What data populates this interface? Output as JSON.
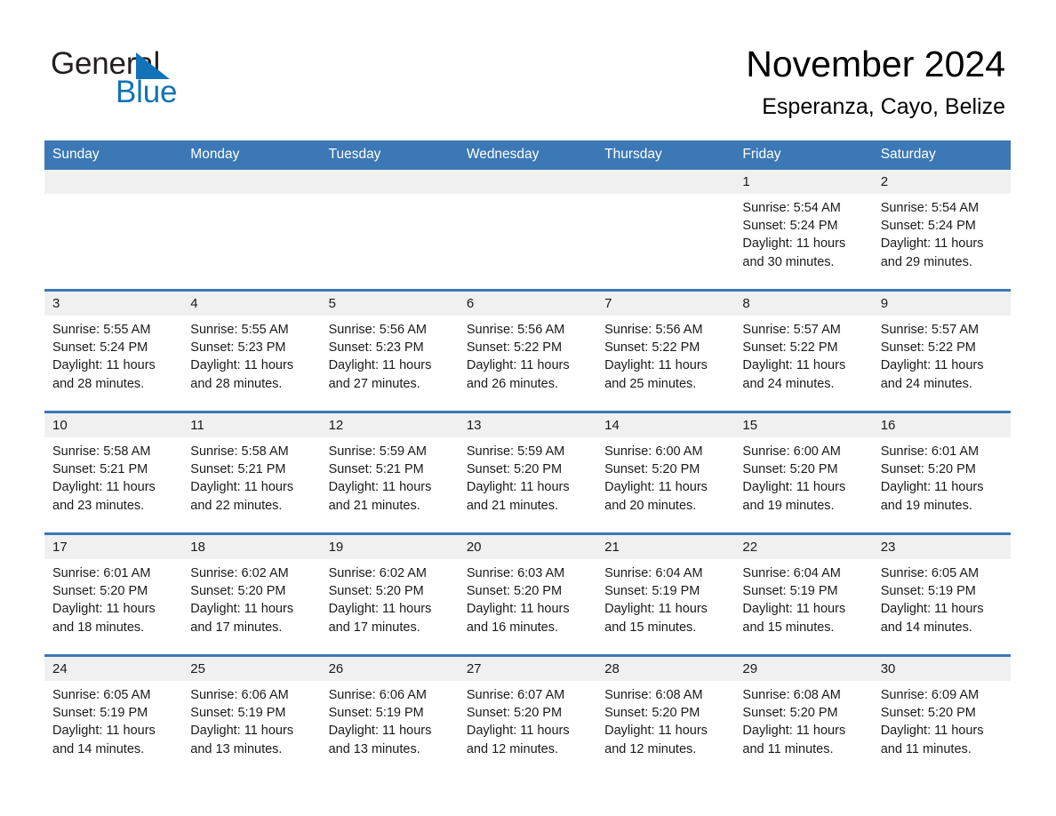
{
  "logo": {
    "text_top": "General",
    "text_bottom": "Blue",
    "triangle_icon": "blue-triangle-icon",
    "colors": {
      "black": "#231f20",
      "blue": "#1273b8"
    }
  },
  "header": {
    "title": "November 2024",
    "subtitle": "Esperanza, Cayo, Belize"
  },
  "theme": {
    "header_blue": "#3b78b5",
    "daynum_band_gray": "#f0f0f0",
    "cell_white": "#ffffff",
    "text_black": "#1a1a1a"
  },
  "calendar": {
    "weekday_headers": [
      "Sunday",
      "Monday",
      "Tuesday",
      "Wednesday",
      "Thursday",
      "Friday",
      "Saturday"
    ],
    "weeks": [
      [
        {
          "day": "",
          "sunrise": "",
          "sunset": "",
          "daylight": "",
          "blank": true
        },
        {
          "day": "",
          "sunrise": "",
          "sunset": "",
          "daylight": "",
          "blank": true
        },
        {
          "day": "",
          "sunrise": "",
          "sunset": "",
          "daylight": "",
          "blank": true
        },
        {
          "day": "",
          "sunrise": "",
          "sunset": "",
          "daylight": "",
          "blank": true
        },
        {
          "day": "",
          "sunrise": "",
          "sunset": "",
          "daylight": "",
          "blank": true
        },
        {
          "day": "1",
          "sunrise": "Sunrise: 5:54 AM",
          "sunset": "Sunset: 5:24 PM",
          "daylight": "Daylight: 11 hours and 30 minutes."
        },
        {
          "day": "2",
          "sunrise": "Sunrise: 5:54 AM",
          "sunset": "Sunset: 5:24 PM",
          "daylight": "Daylight: 11 hours and 29 minutes."
        }
      ],
      [
        {
          "day": "3",
          "sunrise": "Sunrise: 5:55 AM",
          "sunset": "Sunset: 5:24 PM",
          "daylight": "Daylight: 11 hours and 28 minutes."
        },
        {
          "day": "4",
          "sunrise": "Sunrise: 5:55 AM",
          "sunset": "Sunset: 5:23 PM",
          "daylight": "Daylight: 11 hours and 28 minutes."
        },
        {
          "day": "5",
          "sunrise": "Sunrise: 5:56 AM",
          "sunset": "Sunset: 5:23 PM",
          "daylight": "Daylight: 11 hours and 27 minutes."
        },
        {
          "day": "6",
          "sunrise": "Sunrise: 5:56 AM",
          "sunset": "Sunset: 5:22 PM",
          "daylight": "Daylight: 11 hours and 26 minutes."
        },
        {
          "day": "7",
          "sunrise": "Sunrise: 5:56 AM",
          "sunset": "Sunset: 5:22 PM",
          "daylight": "Daylight: 11 hours and 25 minutes."
        },
        {
          "day": "8",
          "sunrise": "Sunrise: 5:57 AM",
          "sunset": "Sunset: 5:22 PM",
          "daylight": "Daylight: 11 hours and 24 minutes."
        },
        {
          "day": "9",
          "sunrise": "Sunrise: 5:57 AM",
          "sunset": "Sunset: 5:22 PM",
          "daylight": "Daylight: 11 hours and 24 minutes."
        }
      ],
      [
        {
          "day": "10",
          "sunrise": "Sunrise: 5:58 AM",
          "sunset": "Sunset: 5:21 PM",
          "daylight": "Daylight: 11 hours and 23 minutes."
        },
        {
          "day": "11",
          "sunrise": "Sunrise: 5:58 AM",
          "sunset": "Sunset: 5:21 PM",
          "daylight": "Daylight: 11 hours and 22 minutes."
        },
        {
          "day": "12",
          "sunrise": "Sunrise: 5:59 AM",
          "sunset": "Sunset: 5:21 PM",
          "daylight": "Daylight: 11 hours and 21 minutes."
        },
        {
          "day": "13",
          "sunrise": "Sunrise: 5:59 AM",
          "sunset": "Sunset: 5:20 PM",
          "daylight": "Daylight: 11 hours and 21 minutes."
        },
        {
          "day": "14",
          "sunrise": "Sunrise: 6:00 AM",
          "sunset": "Sunset: 5:20 PM",
          "daylight": "Daylight: 11 hours and 20 minutes."
        },
        {
          "day": "15",
          "sunrise": "Sunrise: 6:00 AM",
          "sunset": "Sunset: 5:20 PM",
          "daylight": "Daylight: 11 hours and 19 minutes."
        },
        {
          "day": "16",
          "sunrise": "Sunrise: 6:01 AM",
          "sunset": "Sunset: 5:20 PM",
          "daylight": "Daylight: 11 hours and 19 minutes."
        }
      ],
      [
        {
          "day": "17",
          "sunrise": "Sunrise: 6:01 AM",
          "sunset": "Sunset: 5:20 PM",
          "daylight": "Daylight: 11 hours and 18 minutes."
        },
        {
          "day": "18",
          "sunrise": "Sunrise: 6:02 AM",
          "sunset": "Sunset: 5:20 PM",
          "daylight": "Daylight: 11 hours and 17 minutes."
        },
        {
          "day": "19",
          "sunrise": "Sunrise: 6:02 AM",
          "sunset": "Sunset: 5:20 PM",
          "daylight": "Daylight: 11 hours and 17 minutes."
        },
        {
          "day": "20",
          "sunrise": "Sunrise: 6:03 AM",
          "sunset": "Sunset: 5:20 PM",
          "daylight": "Daylight: 11 hours and 16 minutes."
        },
        {
          "day": "21",
          "sunrise": "Sunrise: 6:04 AM",
          "sunset": "Sunset: 5:19 PM",
          "daylight": "Daylight: 11 hours and 15 minutes."
        },
        {
          "day": "22",
          "sunrise": "Sunrise: 6:04 AM",
          "sunset": "Sunset: 5:19 PM",
          "daylight": "Daylight: 11 hours and 15 minutes."
        },
        {
          "day": "23",
          "sunrise": "Sunrise: 6:05 AM",
          "sunset": "Sunset: 5:19 PM",
          "daylight": "Daylight: 11 hours and 14 minutes."
        }
      ],
      [
        {
          "day": "24",
          "sunrise": "Sunrise: 6:05 AM",
          "sunset": "Sunset: 5:19 PM",
          "daylight": "Daylight: 11 hours and 14 minutes."
        },
        {
          "day": "25",
          "sunrise": "Sunrise: 6:06 AM",
          "sunset": "Sunset: 5:19 PM",
          "daylight": "Daylight: 11 hours and 13 minutes."
        },
        {
          "day": "26",
          "sunrise": "Sunrise: 6:06 AM",
          "sunset": "Sunset: 5:19 PM",
          "daylight": "Daylight: 11 hours and 13 minutes."
        },
        {
          "day": "27",
          "sunrise": "Sunrise: 6:07 AM",
          "sunset": "Sunset: 5:20 PM",
          "daylight": "Daylight: 11 hours and 12 minutes."
        },
        {
          "day": "28",
          "sunrise": "Sunrise: 6:08 AM",
          "sunset": "Sunset: 5:20 PM",
          "daylight": "Daylight: 11 hours and 12 minutes."
        },
        {
          "day": "29",
          "sunrise": "Sunrise: 6:08 AM",
          "sunset": "Sunset: 5:20 PM",
          "daylight": "Daylight: 11 hours and 11 minutes."
        },
        {
          "day": "30",
          "sunrise": "Sunrise: 6:09 AM",
          "sunset": "Sunset: 5:20 PM",
          "daylight": "Daylight: 11 hours and 11 minutes."
        }
      ]
    ]
  }
}
